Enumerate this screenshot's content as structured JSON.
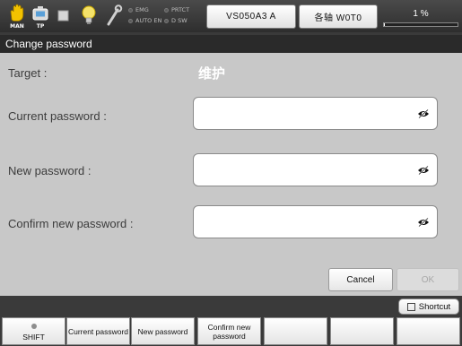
{
  "status": {
    "icons": [
      {
        "name": "hand-icon",
        "caption": "MAN"
      },
      {
        "name": "teach-pendant-icon",
        "caption": "TP"
      },
      {
        "name": "stop-square-icon",
        "caption": ""
      },
      {
        "name": "lightbulb-icon",
        "caption": ""
      },
      {
        "name": "wrench-icon",
        "caption": ""
      }
    ],
    "indicators": [
      "EMG",
      "PRTCT",
      "AUTO EN",
      "D SW"
    ],
    "robot_button": "VS050A3 A",
    "axis_button": "各轴 W0T0",
    "speed_percent": "1 %",
    "speed_fraction": 0.01
  },
  "title": "Change password",
  "form": {
    "target_label": "Target :",
    "target_value": "维护",
    "current_label": "Current password :",
    "new_label": "New password :",
    "confirm_label": "Confirm new password :",
    "current_value": "",
    "new_value": "",
    "confirm_value": ""
  },
  "buttons": {
    "cancel": "Cancel",
    "ok": "OK",
    "shortcut": "Shortcut"
  },
  "function_keys": {
    "shift": "SHIFT",
    "current_password": "Current password",
    "new_password": "New password",
    "confirm_new_password": "Confirm new password",
    "f5": "",
    "f6": "",
    "f7": ""
  }
}
